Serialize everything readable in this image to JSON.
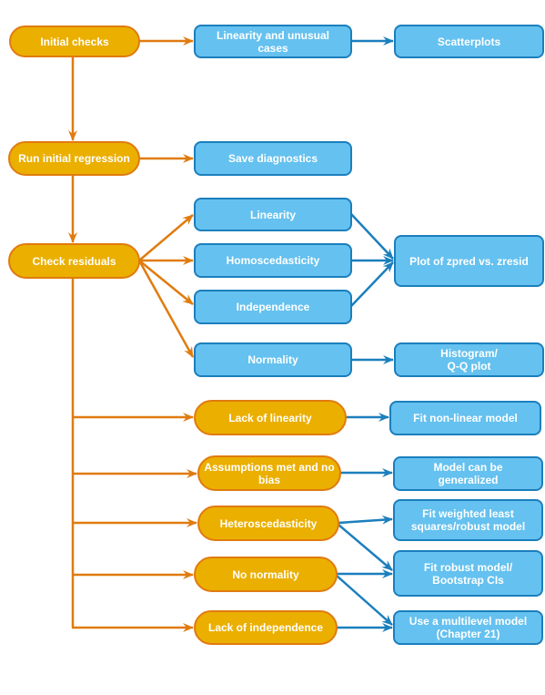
{
  "diagram": {
    "colors": {
      "process_fill": "#ebaf00",
      "process_stroke": "#e07b0f",
      "action_fill": "#65c1ef",
      "action_stroke": "#1b7fbd",
      "orange_arrow": "#e07b0f",
      "blue_arrow": "#1b7fbd",
      "text": "#ffffff"
    },
    "nodes": {
      "initial_checks": "Initial checks",
      "linearity_unusual": "Linearity and unusual cases",
      "scatterplots": "Scatterplots",
      "run_regression": "Run initial regression",
      "save_diagnostics": "Save diagnostics",
      "check_residuals": "Check residuals",
      "linearity": "Linearity",
      "homoscedasticity": "Homoscedasticity",
      "independence": "Independence",
      "normality": "Normality",
      "plot_zpred": "Plot of zpred vs. zresid",
      "histogram_qq": "Histogram/ Q-Q plot",
      "lack_linearity": "Lack of linearity",
      "fit_nonlinear": "Fit non-linear model",
      "assumptions_met": "Assumptions met and no bias",
      "model_generalized": "Model can be generalized",
      "heteroscedasticity": "Heteroscedasticity",
      "fit_weighted": "Fit weighted least squares/robust model",
      "no_normality": "No normality",
      "fit_robust": "Fit robust model/ Bootstrap CIs",
      "lack_independence": "Lack of independence",
      "multilevel": "Use a multilevel model (Chapter 21)"
    },
    "edges": [
      [
        "initial_checks",
        "linearity_unusual"
      ],
      [
        "linearity_unusual",
        "scatterplots"
      ],
      [
        "initial_checks",
        "run_regression"
      ],
      [
        "run_regression",
        "save_diagnostics"
      ],
      [
        "run_regression",
        "check_residuals"
      ],
      [
        "check_residuals",
        "linearity"
      ],
      [
        "check_residuals",
        "homoscedasticity"
      ],
      [
        "check_residuals",
        "independence"
      ],
      [
        "check_residuals",
        "normality"
      ],
      [
        "linearity",
        "plot_zpred"
      ],
      [
        "homoscedasticity",
        "plot_zpred"
      ],
      [
        "independence",
        "plot_zpred"
      ],
      [
        "normality",
        "histogram_qq"
      ],
      [
        "check_residuals",
        "lack_linearity"
      ],
      [
        "check_residuals",
        "assumptions_met"
      ],
      [
        "check_residuals",
        "heteroscedasticity"
      ],
      [
        "check_residuals",
        "no_normality"
      ],
      [
        "check_residuals",
        "lack_independence"
      ],
      [
        "lack_linearity",
        "fit_nonlinear"
      ],
      [
        "assumptions_met",
        "model_generalized"
      ],
      [
        "heteroscedasticity",
        "fit_weighted"
      ],
      [
        "heteroscedasticity",
        "fit_robust"
      ],
      [
        "no_normality",
        "fit_robust"
      ],
      [
        "no_normality",
        "multilevel"
      ],
      [
        "lack_independence",
        "multilevel"
      ]
    ]
  }
}
